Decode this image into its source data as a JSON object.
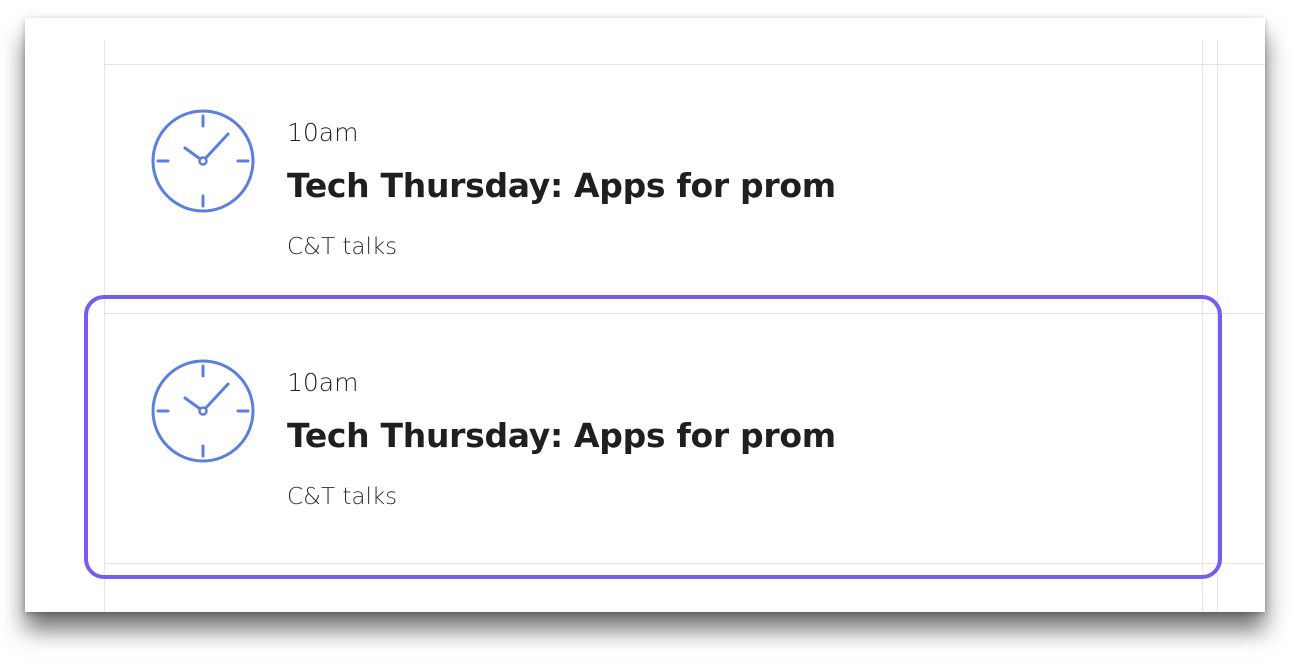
{
  "events": [
    {
      "time": "10am",
      "title": "Tech Thursday: Apps for prom",
      "category": "C&T talks",
      "icon": "clock-icon"
    },
    {
      "time": "10am",
      "title": "Tech Thursday: Apps for prom",
      "category": "C&T talks",
      "icon": "clock-icon"
    }
  ],
  "colors": {
    "icon": "#5b7fdc",
    "highlight": "#7a5af0",
    "divider": "#e3e3e3"
  },
  "selected_index": 1
}
